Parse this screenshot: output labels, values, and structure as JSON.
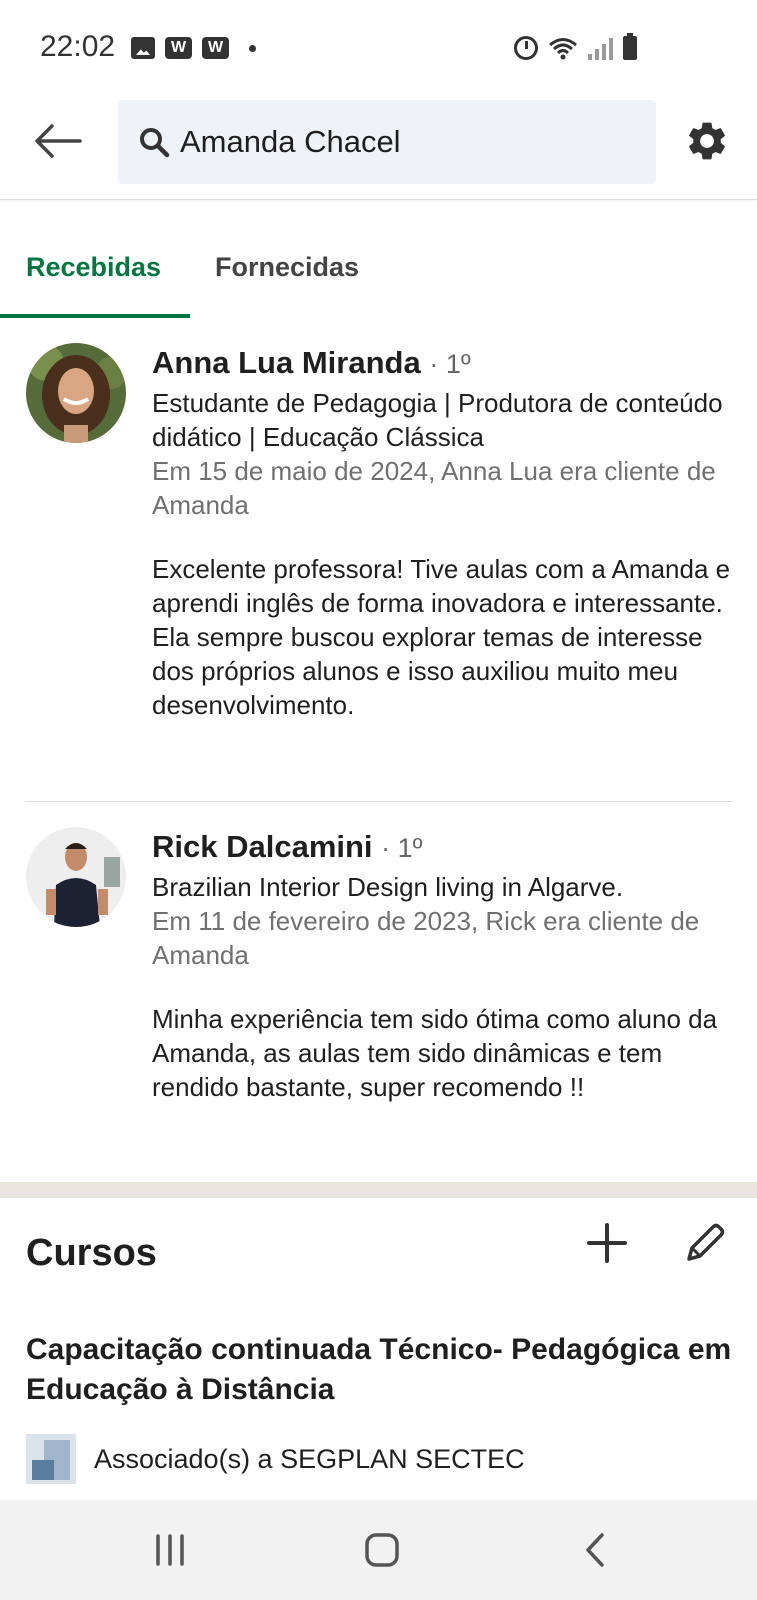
{
  "status_bar": {
    "time": "22:02",
    "notification_w1": "W",
    "notification_w2": "W"
  },
  "search": {
    "value": "Amanda Chacel"
  },
  "tabs": [
    {
      "label": "Recebidas",
      "active": true
    },
    {
      "label": "Fornecidas",
      "active": false
    }
  ],
  "recommendations": [
    {
      "name": "Anna Lua Miranda",
      "degree": "· 1º",
      "headline": "Estudante de Pedagogia | Produtora de conteúdo didático | Educação Clássica",
      "meta": "Em 15 de maio de 2024, Anna Lua era cliente de Amanda",
      "text": "Excelente professora! Tive aulas com a Amanda e aprendi inglês de forma inovadora e interessante. Ela sempre buscou explorar temas de interesse dos próprios alunos e isso auxiliou muito meu desenvolvimento."
    },
    {
      "name": "Rick Dalcamini",
      "degree": "· 1º",
      "headline": "Brazilian Interior Design living in Algarve.",
      "meta": "Em 11 de fevereiro de 2023, Rick era cliente de Amanda",
      "text": "Minha experiência tem sido ótima como aluno da Amanda, as aulas tem sido dinâmicas e tem rendido bastante, super recomendo !!"
    }
  ],
  "courses": {
    "title": "Cursos",
    "items": [
      {
        "title": "Capacitação continuada Técnico- Pedagógica em Educação à Distância",
        "association": "Associado(s) a SEGPLAN SECTEC"
      }
    ]
  },
  "colors": {
    "accent": "#057642",
    "search_bg": "#edf3f8",
    "section_gap": "#e9e5df"
  }
}
